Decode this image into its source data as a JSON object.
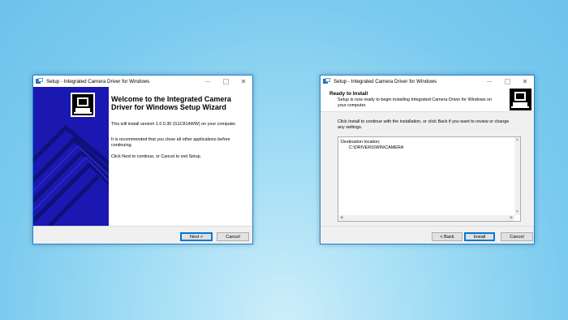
{
  "welcome_window": {
    "title": "Setup - Integrated Camera Driver for Windows",
    "heading": "Welcome to the Integrated Camera Driver for Windows Setup Wizard",
    "para1": "This will install version 1.0.0.30 (G1C814WW) on your computer.",
    "para2": "It is recommended that you close all other applications before continuing.",
    "para3": "Click Next to continue, or Cancel to exit Setup.",
    "next_label": "Next >",
    "cancel_label": "Cancel"
  },
  "ready_window": {
    "title": "Setup - Integrated Camera Driver for Windows",
    "header_title": "Ready to Install",
    "header_subtitle": "Setup is now ready to begin installing Integrated Camera Driver for Windows on your computer.",
    "intro": "Click Install to continue with the installation, or click Back if you want to review or change any settings.",
    "memo_label": "Destination location:",
    "memo_value": "C:\\DRIVERS\\WIN\\CAMERA",
    "back_label": "< Back",
    "install_label": "Install",
    "cancel_label": "Cancel"
  },
  "colors": {
    "banner_blue": "#1a18b0",
    "window_border": "#1883d7",
    "default_button_border": "#0078d7"
  },
  "icons": [
    "setup-app-icon",
    "installer-computer-icon",
    "minimize-icon",
    "maximize-icon",
    "close-icon"
  ]
}
